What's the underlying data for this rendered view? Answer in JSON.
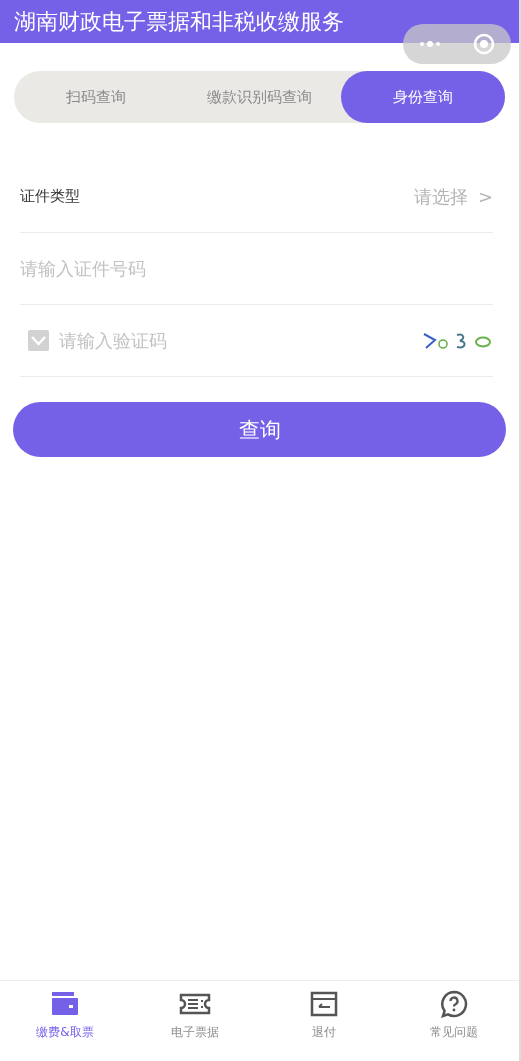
{
  "header": {
    "title": "湖南财政电子票据和非税收缴服务"
  },
  "tabs": [
    {
      "label": "扫码查询",
      "selected": false
    },
    {
      "label": "缴款识别码查询",
      "selected": false
    },
    {
      "label": "身份查询",
      "selected": true
    }
  ],
  "form": {
    "id_type": {
      "label": "证件类型",
      "value": "请选择",
      "chevron": ">"
    },
    "id_number": {
      "placeholder": "请输入证件号码"
    },
    "captcha": {
      "checked": true,
      "placeholder": "请输入验证码"
    },
    "submit": "查询"
  },
  "bottom_nav": [
    {
      "kind": "wallet",
      "label": "缴费&取票",
      "selected": true
    },
    {
      "kind": "ticket",
      "label": "电子票据",
      "selected": false
    },
    {
      "kind": "refund",
      "label": "退付",
      "selected": false
    },
    {
      "kind": "help",
      "label": "常见问题",
      "selected": false
    }
  ]
}
